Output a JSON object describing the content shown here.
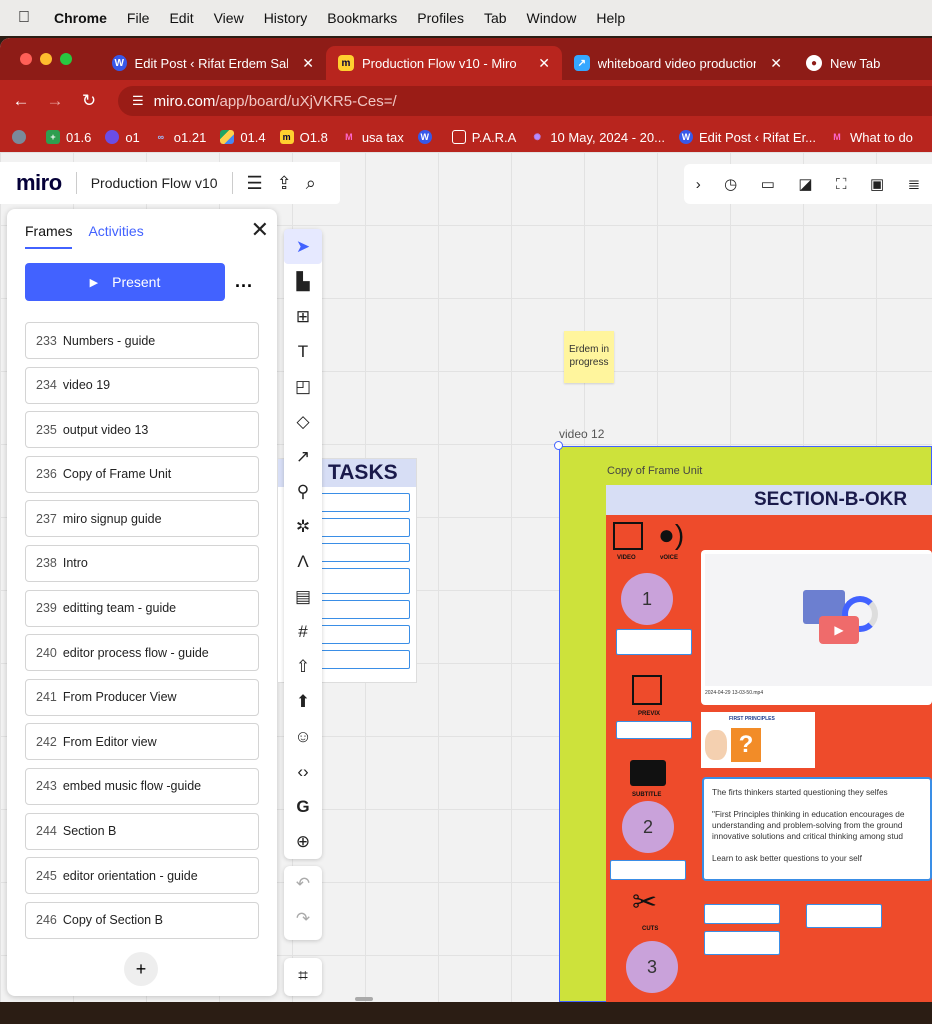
{
  "menubar": {
    "app": "Chrome",
    "items": [
      "File",
      "Edit",
      "View",
      "History",
      "Bookmarks",
      "Profiles",
      "Tab",
      "Window",
      "Help"
    ]
  },
  "tabs": [
    {
      "title": "Edit Post ‹ Rifat Erdem Sahin",
      "icon": "wordpress-icon",
      "active": false
    },
    {
      "title": "Production Flow v10 - Miro",
      "icon": "miro-icon",
      "active": true
    },
    {
      "title": "whiteboard video production",
      "icon": "app-icon",
      "active": false
    },
    {
      "title": "New Tab",
      "icon": "chrome-icon",
      "active": false
    }
  ],
  "address": {
    "host": "miro.com",
    "path": "/app/board/uXjVKR5-Ces=/"
  },
  "bookmarks": [
    "01.6",
    "o1",
    "o1.21",
    "01.4",
    "O1.8",
    "usa tax",
    "",
    "P.A.R.A",
    "10 May, 2024 - 20...",
    "Edit Post ‹ Rifat Er...",
    "What to do"
  ],
  "miro": {
    "logo": "miro",
    "board_name": "Production Flow v10"
  },
  "panel": {
    "tab_frames": "Frames",
    "tab_activities": "Activities",
    "present_label": "Present",
    "more": "...",
    "add": "+",
    "frames": [
      {
        "num": "233",
        "name": "Numbers - guide"
      },
      {
        "num": "234",
        "name": "video 19"
      },
      {
        "num": "235",
        "name": "output video 13"
      },
      {
        "num": "236",
        "name": "Copy of Frame Unit"
      },
      {
        "num": "237",
        "name": "miro signup guide"
      },
      {
        "num": "238",
        "name": "Intro"
      },
      {
        "num": "239",
        "name": "editting team - guide"
      },
      {
        "num": "240",
        "name": "editor process flow - guide"
      },
      {
        "num": "241",
        "name": "From Producer View"
      },
      {
        "num": "242",
        "name": "From Editor view"
      },
      {
        "num": "243",
        "name": "embed music flow -guide"
      },
      {
        "num": "244",
        "name": "Section B"
      },
      {
        "num": "245",
        "name": "editor orientation - guide"
      },
      {
        "num": "246",
        "name": "Copy of Section B"
      }
    ]
  },
  "canvas": {
    "tasks_title": "TASKS",
    "sticky_note": "Erdem in progress",
    "frame_label": "video 12",
    "subframe_label": "Copy of Frame Unit",
    "section_title": "SECTION-B-OKR",
    "labels": {
      "video": "VIDEO",
      "voice": "vOICE",
      "previx": "PREVIX",
      "subtitle": "SUBTITLE",
      "cuts": "CUTS"
    },
    "steps": [
      "1",
      "2",
      "3"
    ],
    "video_caption": "2024-04-29 13-03-50.mp4",
    "fp_title": "FIRST PRINCIPLES",
    "textcard": [
      "The firts thinkers started questioning they selfes",
      "\"First Principles thinking in education encourages de",
      "understanding and problem-solving from the ground",
      "innovative solutions and critical thinking among stud",
      "Learn to ask better questions to your self"
    ]
  }
}
